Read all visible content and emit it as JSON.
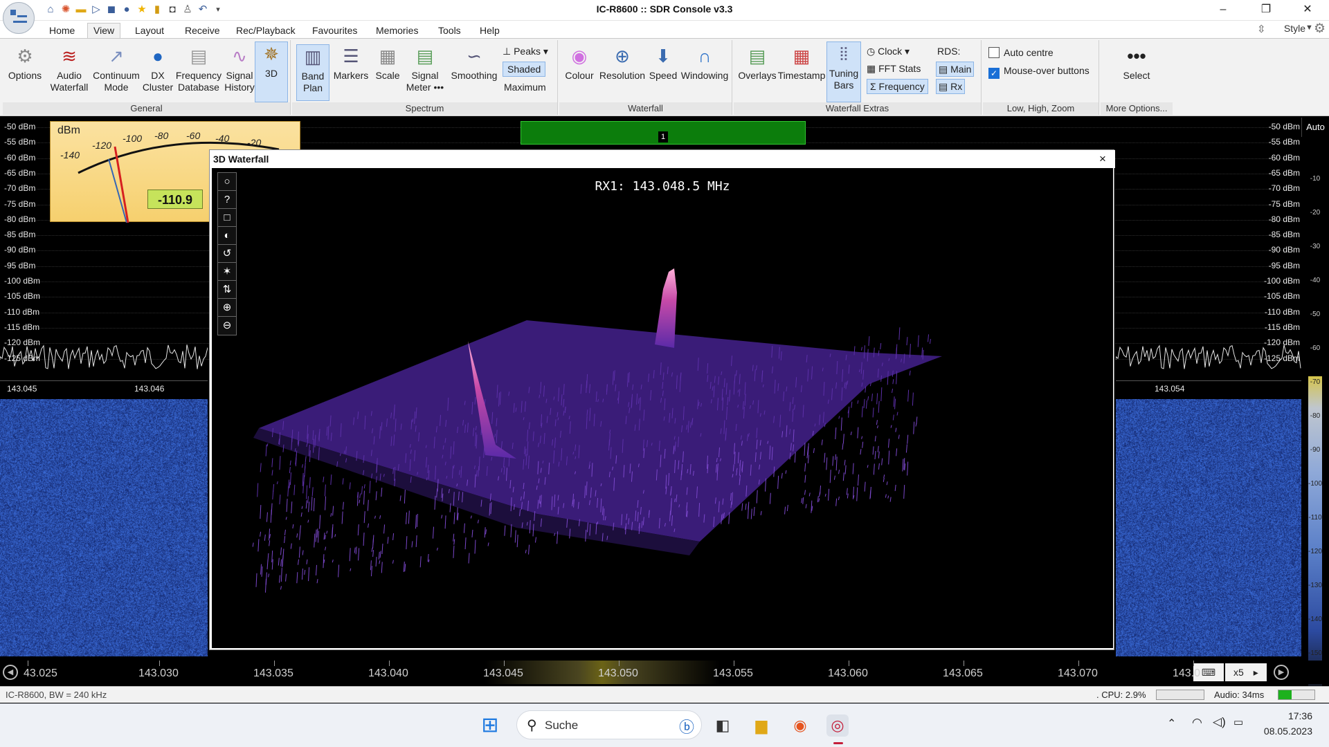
{
  "window": {
    "title": "IC-R8600 :: SDR Console v3.3"
  },
  "tabs": [
    "Home",
    "View",
    "Layout",
    "Receive",
    "Rec/Playback",
    "Favourites",
    "Memories",
    "Tools",
    "Help"
  ],
  "active_tab": "View",
  "style_label": "Style",
  "ribbon": {
    "general": {
      "label": "General",
      "options": "Options",
      "audio": "Audio",
      "waterfall": "Waterfall",
      "continuum": "Continuum",
      "mode": "Mode",
      "dx": "DX",
      "cluster": "Cluster",
      "frequency": "Frequency",
      "database": "Database",
      "signal": "Signal",
      "history": "History",
      "three_d": "3D"
    },
    "spectrum": {
      "label": "Spectrum",
      "band": "Band",
      "plan": "Plan",
      "markers": "Markers",
      "scale": "Scale",
      "signal": "Signal",
      "meter": "Meter •••",
      "smoothing": "Smoothing",
      "peaks": "Peaks",
      "shaded": "Shaded",
      "maximum": "Maximum"
    },
    "waterfall": {
      "label": "Waterfall",
      "colour": "Colour",
      "resolution": "Resolution",
      "speed": "Speed",
      "windowing": "Windowing"
    },
    "extras": {
      "label": "Waterfall Extras",
      "overlays": "Overlays",
      "timestamp": "Timestamp",
      "tuning": "Tuning",
      "bars": "Bars",
      "clock": "Clock",
      "fft_stats": "FFT Stats",
      "frequency": "Frequency",
      "rds": "RDS:",
      "main": "Main",
      "rx": "Rx"
    },
    "zoom": {
      "label": "Low, High, Zoom",
      "auto_centre": "Auto centre",
      "mouse_over": "Mouse-over buttons"
    },
    "more": {
      "label": "More Options...",
      "select": "Select"
    }
  },
  "spectrum": {
    "auto_label": "Auto",
    "db_labels": [
      "-50 dBm",
      "-55 dBm",
      "-60 dBm",
      "-65 dBm",
      "-70 dBm",
      "-75 dBm",
      "-80 dBm",
      "-85 dBm",
      "-90 dBm",
      "-95 dBm",
      "-100 dBm",
      "-105 dBm",
      "-110 dBm",
      "-115 dBm",
      "-120 dBm",
      "-125 dBm"
    ],
    "left_freqs": [
      "143.045",
      "143.046"
    ],
    "right_freq": "143.054",
    "rx_number": "1",
    "right_scale": [
      "-10",
      "-20",
      "-30",
      "-40",
      "-50",
      "-60",
      "-70",
      "-80",
      "-90",
      "-100",
      "-110",
      "-120",
      "-130",
      "-140",
      "-150"
    ]
  },
  "meter": {
    "unit": "dBm",
    "scale": [
      "-140",
      "-120",
      "-100",
      "-80",
      "-60",
      "-40",
      "-20"
    ],
    "reading": "-110.9"
  },
  "waterfall3d": {
    "title": "3D Waterfall",
    "close": "×",
    "freq_label": "RX1: 143.048.5 MHz",
    "tools": [
      "○",
      "?",
      "□",
      "◐",
      "↺",
      "✶",
      "⇅",
      "⊕",
      "⊖"
    ]
  },
  "freq_axis": {
    "labels": [
      "43.025",
      "143.030",
      "143.035",
      "143.040",
      "143.045",
      "143.050",
      "143.055",
      "143.060",
      "143.065",
      "143.070",
      "143.0"
    ],
    "zoom": "x5"
  },
  "status": {
    "left": "IC-R8600, BW = 240 kHz",
    "cpu": ". CPU: 2.9%",
    "audio": "Audio: 34ms"
  },
  "taskbar": {
    "search": "Suche",
    "time": "17:36",
    "date": "08.05.2023"
  }
}
